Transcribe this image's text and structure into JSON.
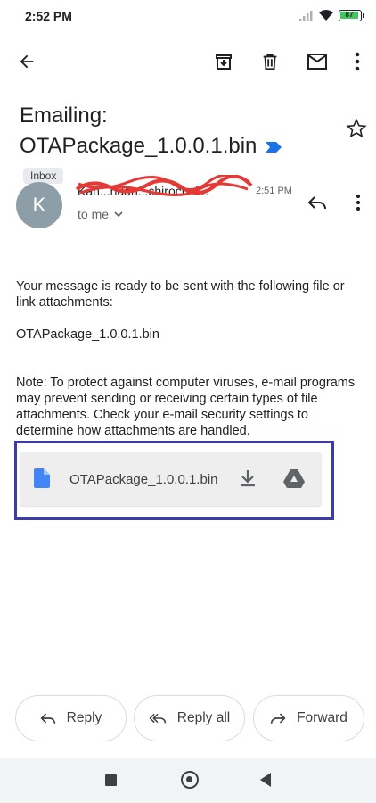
{
  "status_bar": {
    "time": "2:52 PM",
    "battery": "87"
  },
  "toolbar": {
    "back_icon": "arrow-back-icon",
    "archive_icon": "archive-icon",
    "delete_icon": "trash-icon",
    "mark_unread_icon": "mail-icon",
    "more_icon": "more-vert-icon"
  },
  "email": {
    "subject_line1": "Emailing:",
    "subject_line2": "OTAPackage_1.0.0.1.bin",
    "label_chip": "Inbox",
    "sender_initial": "K",
    "sender_name": "Kan...ndan...chirochni...",
    "time": "2:51 PM",
    "recipient": "to me",
    "body_p1": "Your message is ready to be sent with the following file or link attachments:",
    "body_p2": "OTAPackage_1.0.0.1.bin",
    "body_p3": "Note: To protect against computer viruses, e-mail programs may prevent sending or receiving certain types of file attachments.  Check your e-mail security settings to determine how attachments are handled."
  },
  "attachment": {
    "filename": "OTAPackage_1.0.0.1.bin",
    "file_icon": "document-icon",
    "download_icon": "download-icon",
    "drive_icon": "google-drive-icon"
  },
  "actions": {
    "reply": "Reply",
    "reply_all": "Reply all",
    "forward": "Forward"
  },
  "colors": {
    "avatar": "#8e9ea8",
    "highlight_border": "#3c3ca8",
    "important_marker": "#1a73e8",
    "file_icon": "#4285f4",
    "redaction": "#e53935"
  }
}
